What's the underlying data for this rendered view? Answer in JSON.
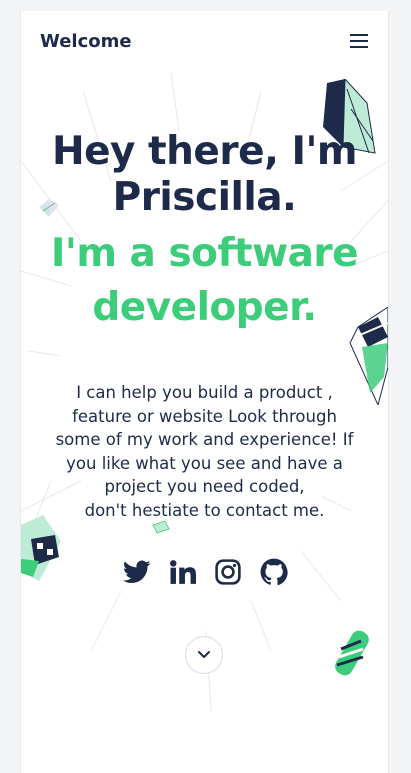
{
  "nav": {
    "brand": "Welcome",
    "menu_icon": "hamburger-menu-icon"
  },
  "hero": {
    "headline_line1": "Hey there, I'm",
    "headline_line2": "Priscilla.",
    "tagline_line1": "I'm a software",
    "tagline_line2": "developer."
  },
  "intro": "I can help you build a product ,\nfeature or website Look through\nsome of my work and experience! If\nyou like what you see and have a\nproject you need coded,\ndon't hestiate to contact me.",
  "socials": [
    {
      "name": "twitter",
      "icon": "twitter-icon"
    },
    {
      "name": "linkedin",
      "icon": "linkedin-icon"
    },
    {
      "name": "instagram",
      "icon": "instagram-icon"
    },
    {
      "name": "github",
      "icon": "github-icon"
    }
  ],
  "scroll_icon": "chevron-down-icon",
  "colors": {
    "navy": "#1e2a4a",
    "green": "#3dcc7a",
    "mint": "#bdebd5",
    "background": "#ffffff"
  }
}
